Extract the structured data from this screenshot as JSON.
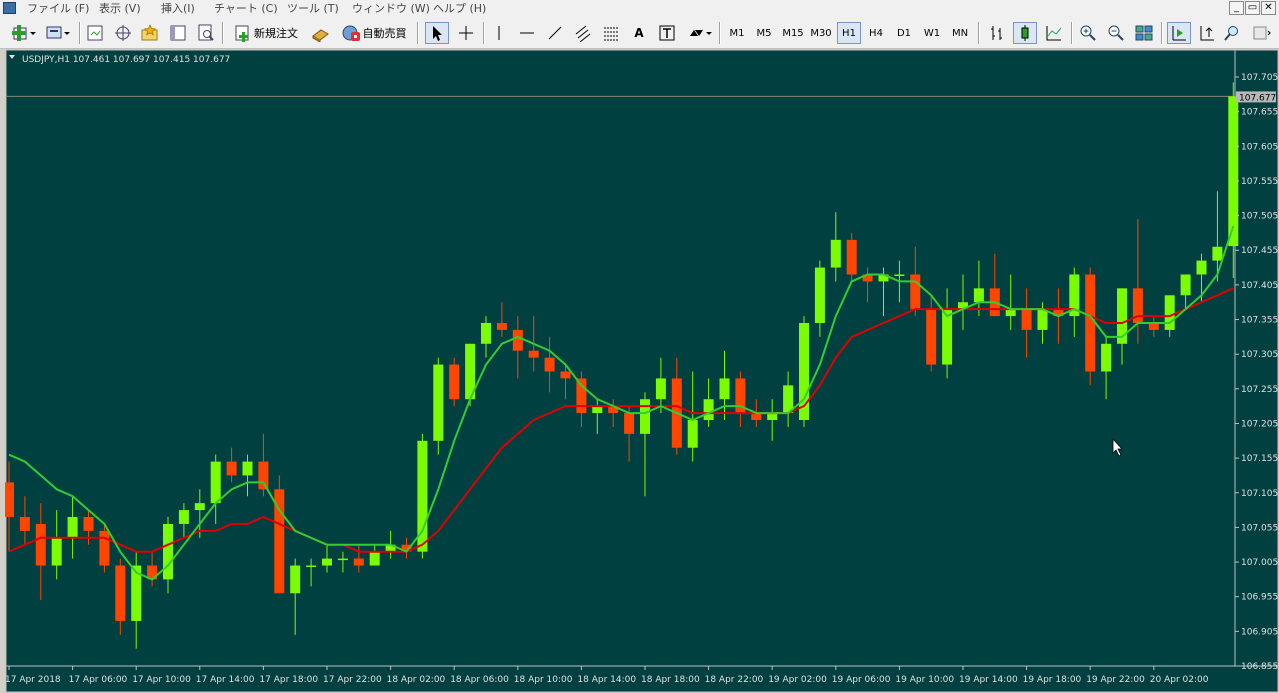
{
  "window": {
    "menu": [
      "ファイル (F)",
      "表示 (V)",
      "挿入(I)",
      "チャート (C)",
      "ツール (T)",
      "ウィンドウ (W)",
      "ヘルプ (H)"
    ],
    "controls": [
      "_",
      "▭",
      "✕"
    ]
  },
  "toolbar": {
    "new_order": "新規注文",
    "auto_trade": "自動売買",
    "text_tool": "A",
    "timeframes": [
      "M1",
      "M5",
      "M15",
      "M30",
      "H1",
      "H4",
      "D1",
      "W1",
      "MN"
    ],
    "active_timeframe": "H1"
  },
  "chart_data": {
    "type": "candlestick",
    "symbol_header": "USDJPY,H1  107.461 107.697 107.415 107.677",
    "current_price": "107.677",
    "y_ticks": [
      "107.705",
      "107.655",
      "107.605",
      "107.555",
      "107.505",
      "107.455",
      "107.405",
      "107.355",
      "107.305",
      "107.255",
      "107.205",
      "107.155",
      "107.105",
      "107.055",
      "107.005",
      "106.955",
      "106.905",
      "106.855"
    ],
    "ylim": [
      106.85,
      107.72
    ],
    "x_labels": [
      {
        "index": 0,
        "label": "17 Apr 2018"
      },
      {
        "index": 4,
        "label": "17 Apr 06:00"
      },
      {
        "index": 8,
        "label": "17 Apr 10:00"
      },
      {
        "index": 12,
        "label": "17 Apr 14:00"
      },
      {
        "index": 16,
        "label": "17 Apr 18:00"
      },
      {
        "index": 20,
        "label": "17 Apr 22:00"
      },
      {
        "index": 24,
        "label": "18 Apr 02:00"
      },
      {
        "index": 28,
        "label": "18 Apr 06:00"
      },
      {
        "index": 32,
        "label": "18 Apr 10:00"
      },
      {
        "index": 36,
        "label": "18 Apr 14:00"
      },
      {
        "index": 40,
        "label": "18 Apr 18:00"
      },
      {
        "index": 44,
        "label": "18 Apr 22:00"
      },
      {
        "index": 48,
        "label": "19 Apr 02:00"
      },
      {
        "index": 52,
        "label": "19 Apr 06:00"
      },
      {
        "index": 56,
        "label": "19 Apr 10:00"
      },
      {
        "index": 60,
        "label": "19 Apr 14:00"
      },
      {
        "index": 64,
        "label": "19 Apr 18:00"
      },
      {
        "index": 68,
        "label": "19 Apr 22:00"
      },
      {
        "index": 72,
        "label": "20 Apr 02:00"
      }
    ],
    "candles": [
      [
        107.12,
        107.15,
        107.02,
        107.07
      ],
      [
        107.07,
        107.1,
        107.03,
        107.05
      ],
      [
        107.06,
        107.09,
        106.95,
        107.0
      ],
      [
        107.0,
        107.08,
        106.98,
        107.04
      ],
      [
        107.04,
        107.1,
        107.01,
        107.07
      ],
      [
        107.07,
        107.08,
        107.03,
        107.05
      ],
      [
        107.05,
        107.06,
        106.99,
        107.0
      ],
      [
        107.0,
        107.01,
        106.9,
        106.92
      ],
      [
        106.92,
        107.02,
        106.88,
        107.0
      ],
      [
        107.0,
        107.02,
        106.97,
        106.98
      ],
      [
        106.98,
        107.07,
        106.96,
        107.06
      ],
      [
        107.06,
        107.09,
        107.04,
        107.08
      ],
      [
        107.08,
        107.11,
        107.04,
        107.09
      ],
      [
        107.09,
        107.16,
        107.06,
        107.15
      ],
      [
        107.15,
        107.17,
        107.12,
        107.13
      ],
      [
        107.13,
        107.16,
        107.1,
        107.15
      ],
      [
        107.15,
        107.19,
        107.1,
        107.11
      ],
      [
        107.11,
        107.13,
        106.96,
        106.96
      ],
      [
        106.96,
        107.01,
        106.9,
        107.0
      ],
      [
        107.0,
        107.01,
        106.97,
        107.0
      ],
      [
        107.0,
        107.03,
        106.99,
        107.01
      ],
      [
        107.01,
        107.02,
        106.99,
        107.01
      ],
      [
        107.01,
        107.03,
        106.99,
        107.0
      ],
      [
        107.0,
        107.03,
        107.0,
        107.02
      ],
      [
        107.02,
        107.05,
        107.01,
        107.03
      ],
      [
        107.03,
        107.04,
        107.01,
        107.02
      ],
      [
        107.02,
        107.19,
        107.01,
        107.18
      ],
      [
        107.18,
        107.3,
        107.16,
        107.29
      ],
      [
        107.29,
        107.3,
        107.23,
        107.24
      ],
      [
        107.24,
        107.32,
        107.23,
        107.32
      ],
      [
        107.32,
        107.36,
        107.3,
        107.35
      ],
      [
        107.35,
        107.38,
        107.33,
        107.34
      ],
      [
        107.34,
        107.36,
        107.27,
        107.31
      ],
      [
        107.31,
        107.36,
        107.28,
        107.3
      ],
      [
        107.3,
        107.33,
        107.25,
        107.28
      ],
      [
        107.28,
        107.29,
        107.24,
        107.27
      ],
      [
        107.27,
        107.28,
        107.2,
        107.22
      ],
      [
        107.22,
        107.24,
        107.19,
        107.23
      ],
      [
        107.23,
        107.24,
        107.2,
        107.22
      ],
      [
        107.22,
        107.23,
        107.15,
        107.19
      ],
      [
        107.19,
        107.25,
        107.1,
        107.24
      ],
      [
        107.24,
        107.3,
        107.22,
        107.27
      ],
      [
        107.27,
        107.3,
        107.16,
        107.17
      ],
      [
        107.17,
        107.28,
        107.15,
        107.21
      ],
      [
        107.21,
        107.27,
        107.2,
        107.24
      ],
      [
        107.24,
        107.31,
        107.21,
        107.27
      ],
      [
        107.27,
        107.28,
        107.2,
        107.22
      ],
      [
        107.22,
        107.24,
        107.2,
        107.21
      ],
      [
        107.21,
        107.24,
        107.18,
        107.22
      ],
      [
        107.22,
        107.28,
        107.2,
        107.26
      ],
      [
        107.21,
        107.36,
        107.2,
        107.35
      ],
      [
        107.35,
        107.44,
        107.33,
        107.43
      ],
      [
        107.43,
        107.51,
        107.41,
        107.47
      ],
      [
        107.47,
        107.48,
        107.41,
        107.42
      ],
      [
        107.42,
        107.43,
        107.38,
        107.41
      ],
      [
        107.41,
        107.43,
        107.36,
        107.42
      ],
      [
        107.42,
        107.44,
        107.38,
        107.42
      ],
      [
        107.42,
        107.46,
        107.36,
        107.37
      ],
      [
        107.37,
        107.39,
        107.28,
        107.29
      ],
      [
        107.29,
        107.4,
        107.27,
        107.37
      ],
      [
        107.37,
        107.42,
        107.34,
        107.38
      ],
      [
        107.38,
        107.44,
        107.36,
        107.4
      ],
      [
        107.4,
        107.45,
        107.36,
        107.36
      ],
      [
        107.36,
        107.42,
        107.34,
        107.37
      ],
      [
        107.37,
        107.4,
        107.3,
        107.34
      ],
      [
        107.34,
        107.38,
        107.32,
        107.37
      ],
      [
        107.37,
        107.4,
        107.32,
        107.36
      ],
      [
        107.36,
        107.43,
        107.33,
        107.42
      ],
      [
        107.42,
        107.43,
        107.26,
        107.28
      ],
      [
        107.28,
        107.33,
        107.24,
        107.32
      ],
      [
        107.32,
        107.4,
        107.29,
        107.4
      ],
      [
        107.4,
        107.5,
        107.32,
        107.35
      ],
      [
        107.35,
        107.36,
        107.33,
        107.34
      ],
      [
        107.34,
        107.38,
        107.33,
        107.39
      ],
      [
        107.39,
        107.42,
        107.37,
        107.42
      ],
      [
        107.42,
        107.45,
        107.38,
        107.44
      ],
      [
        107.44,
        107.54,
        107.41,
        107.46
      ],
      [
        107.461,
        107.697,
        107.415,
        107.677
      ]
    ],
    "ma_fast": [
      107.16,
      107.15,
      107.13,
      107.11,
      107.1,
      107.08,
      107.06,
      107.02,
      106.99,
      106.98,
      107.0,
      107.03,
      107.06,
      107.09,
      107.11,
      107.12,
      107.12,
      107.08,
      107.05,
      107.04,
      107.03,
      107.03,
      107.03,
      107.03,
      107.03,
      107.02,
      107.05,
      107.11,
      107.18,
      107.24,
      107.29,
      107.32,
      107.33,
      107.32,
      107.31,
      107.29,
      107.26,
      107.24,
      107.23,
      107.22,
      107.22,
      107.23,
      107.22,
      107.21,
      107.22,
      107.23,
      107.23,
      107.22,
      107.22,
      107.22,
      107.24,
      107.29,
      107.36,
      107.41,
      107.42,
      107.42,
      107.41,
      107.41,
      107.39,
      107.36,
      107.37,
      107.38,
      107.38,
      107.37,
      107.37,
      107.37,
      107.36,
      107.37,
      107.36,
      107.33,
      107.33,
      107.35,
      107.35,
      107.35,
      107.37,
      107.39,
      107.42,
      107.49
    ],
    "ma_slow": [
      107.02,
      107.03,
      107.04,
      107.04,
      107.04,
      107.04,
      107.04,
      107.03,
      107.02,
      107.02,
      107.03,
      107.04,
      107.05,
      107.05,
      107.06,
      107.06,
      107.07,
      107.06,
      107.05,
      107.04,
      107.03,
      107.03,
      107.02,
      107.02,
      107.02,
      107.02,
      107.03,
      107.05,
      107.08,
      107.11,
      107.14,
      107.17,
      107.19,
      107.21,
      107.22,
      107.23,
      107.23,
      107.23,
      107.23,
      107.23,
      107.23,
      107.23,
      107.23,
      107.22,
      107.22,
      107.22,
      107.22,
      107.22,
      107.22,
      107.22,
      107.23,
      107.26,
      107.3,
      107.33,
      107.34,
      107.35,
      107.36,
      107.37,
      107.37,
      107.37,
      107.37,
      107.37,
      107.37,
      107.37,
      107.37,
      107.37,
      107.37,
      107.37,
      107.36,
      107.35,
      107.35,
      107.36,
      107.36,
      107.36,
      107.37,
      107.38,
      107.39,
      107.4
    ],
    "colors": {
      "bull": "#7cfc00",
      "bear": "#ff4500",
      "ma_fast": "#32cd32",
      "ma_slow": "#e00000",
      "background": "#004040",
      "axis_bg": "#004040",
      "text": "#e0e0e0"
    }
  }
}
